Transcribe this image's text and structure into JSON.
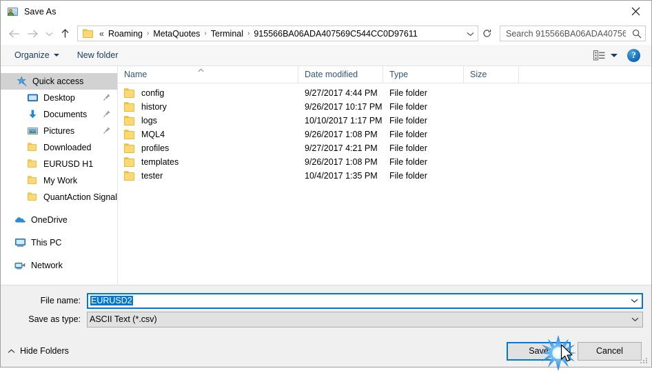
{
  "window": {
    "title": "Save As",
    "icon": "save-as-folder-person-icon",
    "close_label": "✕"
  },
  "navigation": {
    "back_icon": "arrow-left-icon",
    "forward_icon": "arrow-right-icon",
    "recent_icon": "chevron-down-icon",
    "up_icon": "arrow-up-icon",
    "folder_icon": "folder-icon",
    "overflow": "«",
    "breadcrumbs": [
      "Roaming",
      "MetaQuotes",
      "Terminal",
      "915566BA06ADA407569C544CC0D97611"
    ],
    "separator": "›",
    "dropdown_icon": "chevron-down-icon",
    "refresh_icon": "refresh-icon"
  },
  "search": {
    "placeholder": "Search 915566BA06ADA40756...",
    "value": "",
    "icon": "search-icon"
  },
  "toolbar": {
    "organize_label": "Organize",
    "new_folder_label": "New folder",
    "view_icon": "view-layout-icon",
    "view_caret_icon": "caret-down-icon",
    "help_label": "?",
    "help_icon": "help-circle-icon"
  },
  "sidebar": {
    "items": [
      {
        "label": "Quick access",
        "icon": "star-pin-icon",
        "selected": true,
        "indent": false,
        "pinned": false,
        "group": false
      },
      {
        "label": "Desktop",
        "icon": "desktop-icon",
        "selected": false,
        "indent": true,
        "pinned": true,
        "group": false
      },
      {
        "label": "Documents",
        "icon": "documents-arrow-icon",
        "selected": false,
        "indent": true,
        "pinned": true,
        "group": false
      },
      {
        "label": "Pictures",
        "icon": "pictures-icon",
        "selected": false,
        "indent": true,
        "pinned": true,
        "group": false
      },
      {
        "label": "Downloaded",
        "icon": "folder-icon",
        "selected": false,
        "indent": true,
        "pinned": false,
        "group": false
      },
      {
        "label": "EURUSD H1",
        "icon": "folder-icon",
        "selected": false,
        "indent": true,
        "pinned": false,
        "group": false
      },
      {
        "label": "My Work",
        "icon": "folder-icon",
        "selected": false,
        "indent": true,
        "pinned": false,
        "group": false
      },
      {
        "label": "QuantAction Signal",
        "icon": "folder-icon",
        "selected": false,
        "indent": true,
        "pinned": false,
        "group": false
      },
      {
        "label": "OneDrive",
        "icon": "onedrive-cloud-icon",
        "selected": false,
        "indent": false,
        "pinned": false,
        "group": true
      },
      {
        "label": "This PC",
        "icon": "this-pc-monitor-icon",
        "selected": false,
        "indent": false,
        "pinned": false,
        "group": true
      },
      {
        "label": "Network",
        "icon": "network-icon",
        "selected": false,
        "indent": false,
        "pinned": false,
        "group": true
      }
    ]
  },
  "filelist": {
    "columns": [
      "Name",
      "Date modified",
      "Type",
      "Size"
    ],
    "sort_column": "Name",
    "sort_direction": "ascending",
    "rows": [
      {
        "name": "config",
        "date": "9/27/2017 4:44 PM",
        "type": "File folder",
        "size": ""
      },
      {
        "name": "history",
        "date": "9/26/2017 10:17 PM",
        "type": "File folder",
        "size": ""
      },
      {
        "name": "logs",
        "date": "10/10/2017 1:17 PM",
        "type": "File folder",
        "size": ""
      },
      {
        "name": "MQL4",
        "date": "9/26/2017 1:08 PM",
        "type": "File folder",
        "size": ""
      },
      {
        "name": "profiles",
        "date": "9/27/2017 4:21 PM",
        "type": "File folder",
        "size": ""
      },
      {
        "name": "templates",
        "date": "9/26/2017 1:08 PM",
        "type": "File folder",
        "size": ""
      },
      {
        "name": "tester",
        "date": "10/4/2017 1:35 PM",
        "type": "File folder",
        "size": ""
      }
    ]
  },
  "form": {
    "filename_label": "File name:",
    "filename_value": "EURUSD2",
    "filetype_label": "Save as type:",
    "filetype_value": "ASCII Text (*.csv)",
    "dropdown_icon": "chevron-down-icon"
  },
  "footer": {
    "hide_folders_label": "Hide Folders",
    "hide_folders_icon": "chevron-up-icon",
    "save_label": "Save",
    "cancel_label": "Cancel",
    "resize_grip_icon": "resize-grip-icon",
    "cursor_icon": "mouse-pointer-icon",
    "click_effect_icon": "click-burst-icon"
  },
  "colors": {
    "accent": "#0078d7",
    "selection": "#0078d7",
    "folder_yellow": "#fcd975",
    "header_text": "#32557e",
    "command_text": "#1b3c66",
    "selected_row_bg": "#d2d2d2",
    "form_bg": "#f0f0f0"
  }
}
